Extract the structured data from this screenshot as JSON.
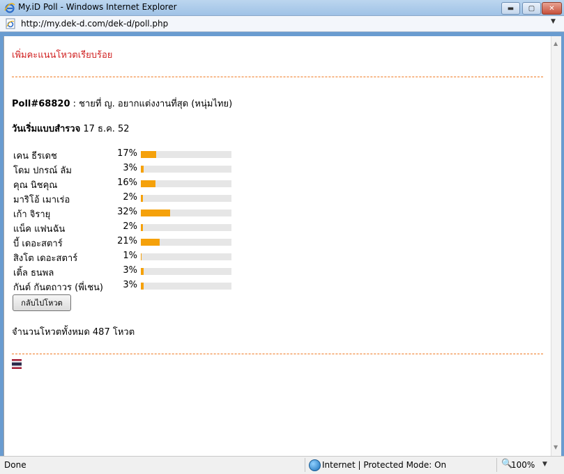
{
  "window": {
    "title": "My.iD Poll - Windows Internet Explorer",
    "minimize": "▬",
    "maximize": "▢",
    "close": "✕"
  },
  "address": {
    "url": "http://my.dek-d.com/dek-d/poll.php"
  },
  "content": {
    "message": "เพิ่มคะแนนโหวตเรียบร้อย",
    "poll_id": "Poll#68820",
    "poll_title": " : ชายที่ ญ. อยากแต่งงานที่สุด (หนุ่มไทย)",
    "start_label": "วันเริ่มแบบสำรวจ",
    "start_date": " 17 ธ.ค. 52",
    "results": [
      {
        "name": "เคน ธีรเดช",
        "pct_text": "17%",
        "value": 17
      },
      {
        "name": "โดม ปกรณ์ ลัม",
        "pct_text": "3%",
        "value": 3
      },
      {
        "name": "คุณ นิชคุณ",
        "pct_text": "16%",
        "value": 16
      },
      {
        "name": "มาริโอ้ เมาเร่อ",
        "pct_text": "2%",
        "value": 2
      },
      {
        "name": "เก้า จิรายุ",
        "pct_text": "32%",
        "value": 32
      },
      {
        "name": "แน็ค แฟนฉัน",
        "pct_text": "2%",
        "value": 2
      },
      {
        "name": "บี้ เดอะสตาร์",
        "pct_text": "21%",
        "value": 21
      },
      {
        "name": "สิงโต เดอะสตาร์",
        "pct_text": "1%",
        "value": 1
      },
      {
        "name": "เติ้ล ธนพล",
        "pct_text": "3%",
        "value": 3
      },
      {
        "name": "กันต์ กันตถาวร (พี่เชน)",
        "pct_text": "3%",
        "value": 3
      }
    ],
    "back_button": "กลับไปโหวต",
    "total_votes": "จำนวนโหวตทั้งหมด 487 โหวต"
  },
  "status": {
    "done": "Done",
    "zone": "Internet | Protected Mode: On",
    "zoom": "100%"
  },
  "colors": {
    "bar": "#f5a10a",
    "track": "#e6e6e6",
    "message": "#d02020",
    "divider": "#f07820"
  }
}
